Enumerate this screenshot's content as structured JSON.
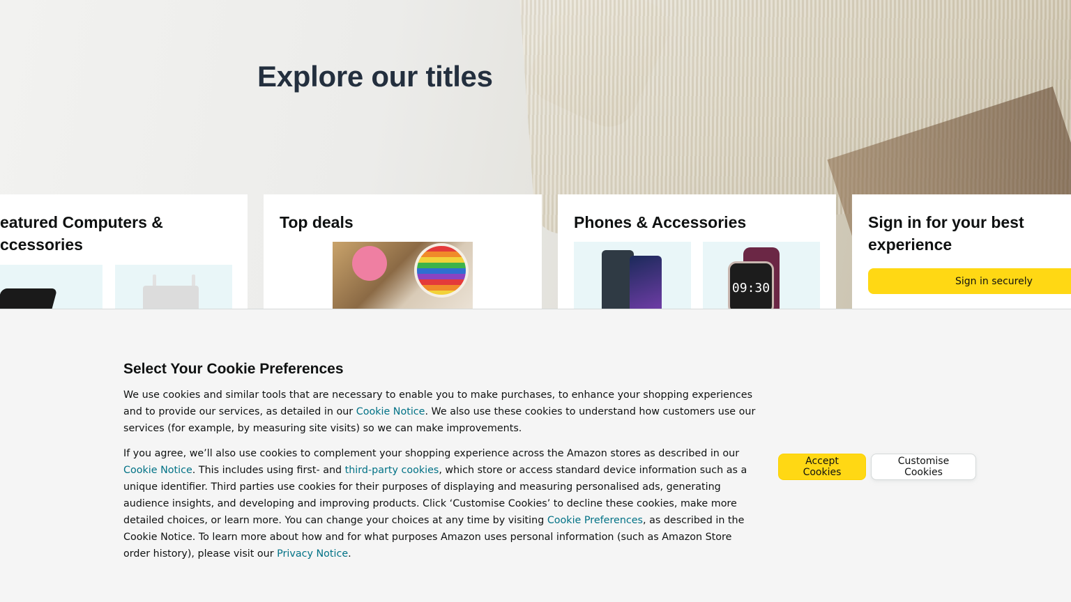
{
  "hero": {
    "title": "Explore our titles"
  },
  "cards": [
    {
      "title": "eatured Computers & ccessories"
    },
    {
      "title": "Top deals"
    },
    {
      "title": "Phones & Accessories",
      "watch_time": "09:30"
    },
    {
      "title": "Sign in for your best experience",
      "button": "Sign in securely"
    }
  ],
  "cookie_banner": {
    "title": "Select Your Cookie Preferences",
    "p1_a": "We use cookies and similar tools that are necessary to enable you to make purchases, to enhance your shopping experiences and to provide our services, as detailed in our ",
    "p1_link": "Cookie Notice",
    "p1_b": ". We also use these cookies to understand how customers use our services (for example, by measuring site visits) so we can make improvements.",
    "p2_a": "If you agree, we’ll also use cookies to complement your shopping experience across the Amazon stores as described in our ",
    "p2_link1": "Cookie Notice",
    "p2_b": ". This includes using first- and ",
    "p2_link2": "third-party cookies",
    "p2_c": ", which store or access standard device information such as a unique identifier. Third parties use cookies for their purposes of displaying and measuring personalised ads, generating audience insights, and developing and improving products. Click ‘Customise Cookies’ to decline these cookies, make more detailed choices, or learn more. You can change your choices at any time by visiting ",
    "p2_link3": "Cookie Preferences",
    "p2_d": ", as described in the Cookie Notice. To learn more about how and for what purposes Amazon uses personal information (such as Amazon Store order history), please visit our ",
    "p2_link4": "Privacy Notice",
    "p2_e": ".",
    "accept_label": "Accept Cookies",
    "customise_label": "Customise Cookies"
  },
  "colors": {
    "accent_yellow": "#ffd814",
    "link_teal": "#007185",
    "banner_bg": "#f5f5f5",
    "hero_title": "#232f3e"
  }
}
